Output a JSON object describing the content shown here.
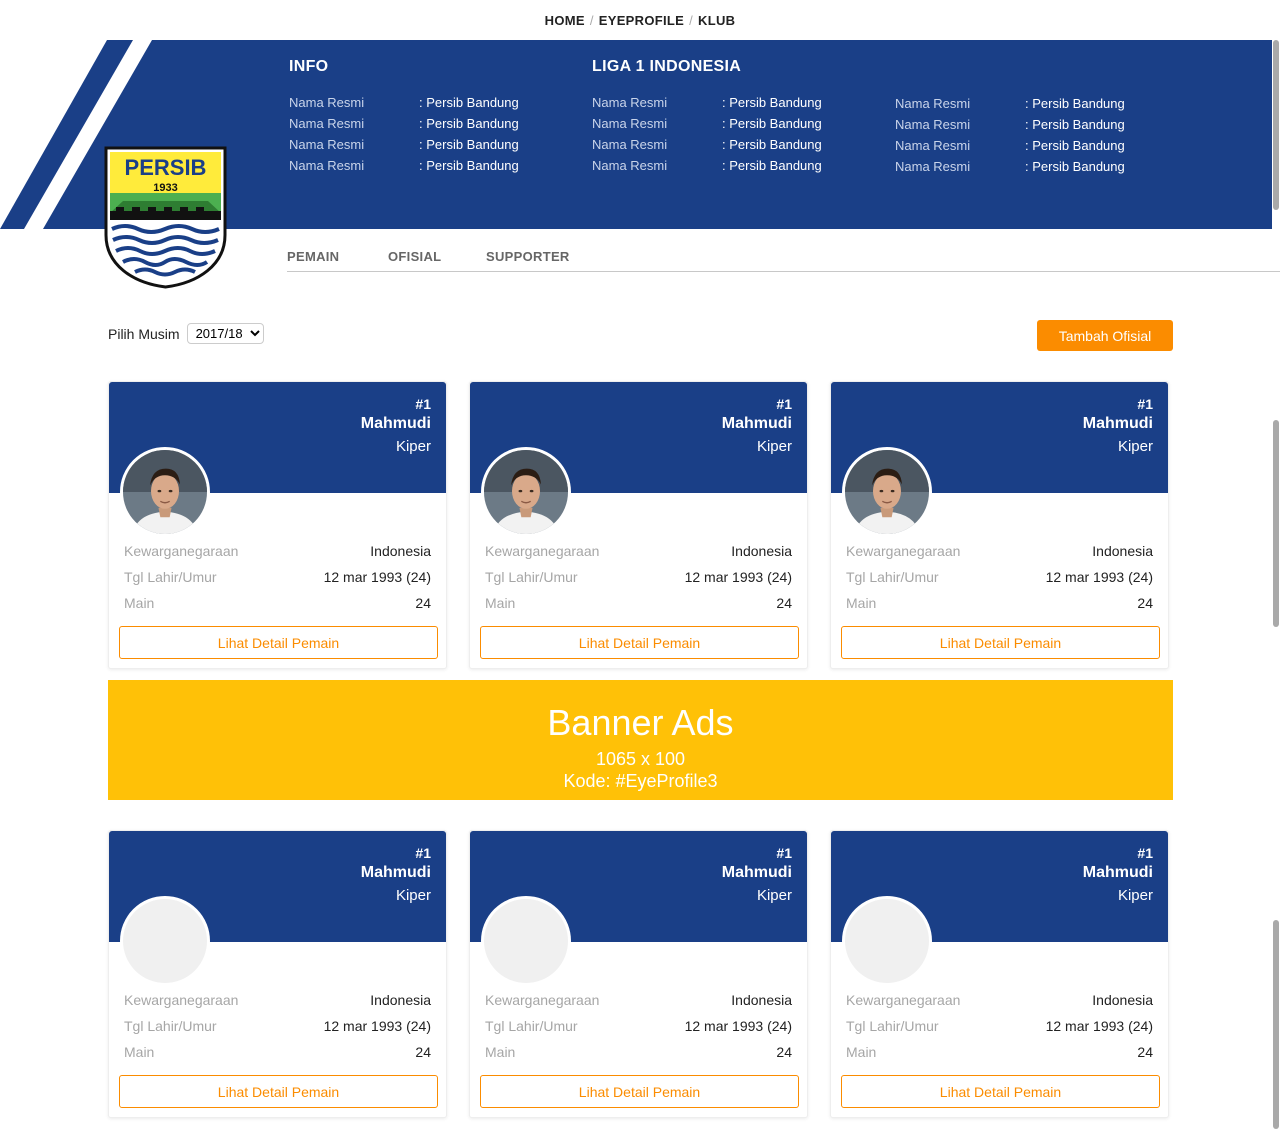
{
  "breadcrumb": [
    "HOME",
    "EYEPROFILE",
    "KLUB"
  ],
  "club": {
    "logo_text": "PERSIB",
    "logo_year": "1933",
    "info_title": "INFO",
    "league_title": "LIGA 1 INDONESIA",
    "columns": [
      [
        {
          "label": "Nama Resmi",
          "value": ": Persib Bandung"
        },
        {
          "label": "Nama Resmi",
          "value": ": Persib Bandung"
        },
        {
          "label": "Nama Resmi",
          "value": ": Persib Bandung"
        },
        {
          "label": "Nama Resmi",
          "value": ": Persib Bandung"
        }
      ],
      [
        {
          "label": "Nama Resmi",
          "value": ": Persib Bandung"
        },
        {
          "label": "Nama Resmi",
          "value": ": Persib Bandung"
        },
        {
          "label": "Nama Resmi",
          "value": ": Persib Bandung"
        },
        {
          "label": "Nama Resmi",
          "value": ": Persib Bandung"
        }
      ],
      [
        {
          "label": "Nama Resmi",
          "value": ": Persib Bandung"
        },
        {
          "label": "Nama Resmi",
          "value": ": Persib Bandung"
        },
        {
          "label": "Nama Resmi",
          "value": ": Persib Bandung"
        },
        {
          "label": "Nama Resmi",
          "value": ": Persib Bandung"
        }
      ]
    ]
  },
  "tabs": [
    "PEMAIN",
    "OFISIAL",
    "SUPPORTER"
  ],
  "season": {
    "label": "Pilih Musim",
    "selected": "2017/18"
  },
  "add_button": "Tambah Ofisial",
  "stat_labels": {
    "nationality": "Kewarganegaraan",
    "birth": "Tgl Lahir/Umur",
    "played": "Main"
  },
  "detail_button": "Lihat Detail Pemain",
  "players": [
    {
      "number": "#1",
      "name": "Mahmudi",
      "position": "Kiper",
      "nationality": "Indonesia",
      "birth": "12 mar 1993 (24)",
      "played": "24",
      "photo": true
    },
    {
      "number": "#1",
      "name": "Mahmudi",
      "position": "Kiper",
      "nationality": "Indonesia",
      "birth": "12 mar 1993 (24)",
      "played": "24",
      "photo": true
    },
    {
      "number": "#1",
      "name": "Mahmudi",
      "position": "Kiper",
      "nationality": "Indonesia",
      "birth": "12 mar 1993 (24)",
      "played": "24",
      "photo": true
    },
    {
      "number": "#1",
      "name": "Mahmudi",
      "position": "Kiper",
      "nationality": "Indonesia",
      "birth": "12 mar 1993 (24)",
      "played": "24",
      "photo": false
    },
    {
      "number": "#1",
      "name": "Mahmudi",
      "position": "Kiper",
      "nationality": "Indonesia",
      "birth": "12 mar 1993 (24)",
      "played": "24",
      "photo": false
    },
    {
      "number": "#1",
      "name": "Mahmudi",
      "position": "Kiper",
      "nationality": "Indonesia",
      "birth": "12 mar 1993 (24)",
      "played": "24",
      "photo": false
    }
  ],
  "banner": {
    "title": "Banner Ads",
    "size": "1065 x 100",
    "code": "Kode: #EyeProfile3"
  },
  "colors": {
    "brand_blue": "#1a3f87",
    "accent_orange": "#fb8c00",
    "banner_yellow": "#ffc107"
  }
}
